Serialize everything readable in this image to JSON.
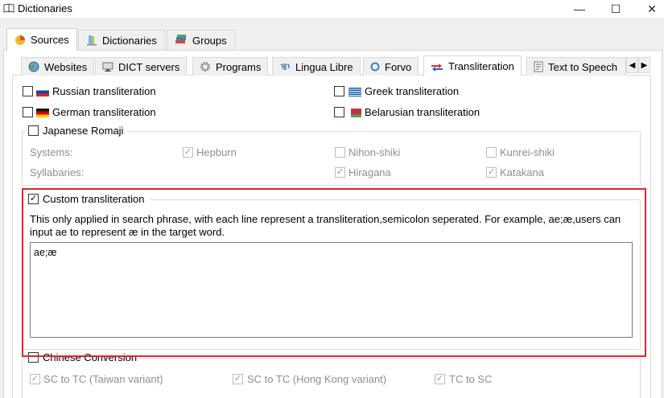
{
  "window": {
    "title": "Dictionaries",
    "minimize_glyph": "—",
    "maximize_glyph": "☐",
    "close_glyph": "✕"
  },
  "top_tabs": [
    {
      "label": "Sources",
      "icon": "sources-icon",
      "active": true
    },
    {
      "label": "Dictionaries",
      "icon": "dictionaries-icon",
      "active": false
    },
    {
      "label": "Groups",
      "icon": "groups-icon",
      "active": false
    }
  ],
  "source_tabs": [
    {
      "label": "Websites",
      "icon": "globe-icon"
    },
    {
      "label": "DICT servers",
      "icon": "dict-server-icon"
    },
    {
      "label": "Programs",
      "icon": "gear-icon"
    },
    {
      "label": "Lingua Libre",
      "icon": "lingua-libre-icon"
    },
    {
      "label": "Forvo",
      "icon": "forvo-icon"
    },
    {
      "label": "Transliteration",
      "icon": "transliteration-icon",
      "active": true
    },
    {
      "label": "Text to Speech",
      "icon": "text-to-speech-icon"
    }
  ],
  "tab_scroll": {
    "left": "◀",
    "right": "▶"
  },
  "transliteration": {
    "russian": {
      "label": "Russian transliteration",
      "checked": false
    },
    "greek": {
      "label": "Greek transliteration",
      "checked": false
    },
    "german": {
      "label": "German transliteration",
      "checked": false
    },
    "belarusian": {
      "label": "Belarusian transliteration",
      "checked": false
    },
    "japanese": {
      "label": "Japanese Romaji",
      "checked": false,
      "systems_label": "Systems:",
      "syllabaries_label": "Syllabaries:",
      "hepburn": {
        "label": "Hepburn",
        "checked": true
      },
      "nihon_shiki": {
        "label": "Nihon-shiki",
        "checked": false
      },
      "kunrei_shiki": {
        "label": "Kunrei-shiki",
        "checked": false
      },
      "hiragana": {
        "label": "Hiragana",
        "checked": true
      },
      "katakana": {
        "label": "Katakana",
        "checked": true
      }
    },
    "custom": {
      "label": "Custom transliteration",
      "checked": true,
      "description_line1": "This only applied in search phrase, with each line represent a transliteration,semicolon seperated. For example, ae;æ,users can",
      "description_line2": "input ae to represent æ in the target word.",
      "value": "ae;æ"
    },
    "chinese": {
      "label": "Chinese Conversion",
      "checked": false,
      "sc_to_tc_taiwan": {
        "label": "SC to TC (Taiwan variant)",
        "checked": true
      },
      "sc_to_tc_hk": {
        "label": "SC to TC (Hong Kong variant)",
        "checked": true
      },
      "tc_to_sc": {
        "label": "TC to SC",
        "checked": true
      }
    }
  },
  "colors": {
    "highlight_border": "#e0262e"
  }
}
